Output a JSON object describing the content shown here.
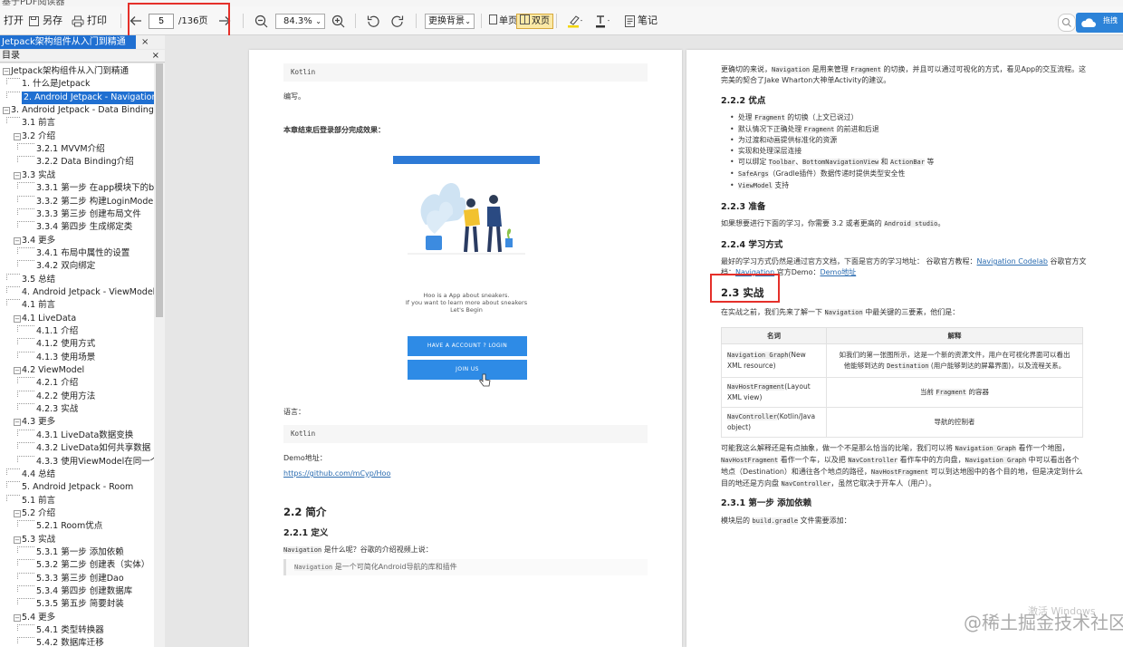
{
  "window_title": "基于PDF阅读器",
  "toolbar": {
    "open": "打开",
    "save_as": "另存",
    "print": "打印",
    "page_current": "5",
    "page_total": "/136页",
    "zoom": "84.3%",
    "background": "更换背景",
    "single_page": "单页",
    "double_page": "双页",
    "note": "笔记"
  },
  "corner_badge": "拖拽",
  "tab": {
    "label": "Jetpack架构组件从入门到精通",
    "close": "×"
  },
  "toc_header": {
    "label": "目录",
    "close": "×"
  },
  "toc": [
    {
      "label": "Jetpack架构组件从入门到精通",
      "level": 0
    },
    {
      "label": "1. 什么是Jetpack",
      "level": 1
    },
    {
      "label": "2. Android Jetpack - Navigation",
      "level": 1,
      "selected": true
    },
    {
      "label": "3. Android Jetpack - Data Binding",
      "level": 0
    },
    {
      "label": "3.1 前言",
      "level": 1
    },
    {
      "label": "3.2 介绍",
      "level": 1
    },
    {
      "label": "3.2.1 MVVM介绍",
      "level": 2
    },
    {
      "label": "3.2.2 Data Binding介绍",
      "level": 2
    },
    {
      "label": "3.3 实战",
      "level": 1
    },
    {
      "label": "3.3.1 第一步 在app模块下的build",
      "level": 2
    },
    {
      "label": "3.3.2 第二步 构建LoginModel",
      "level": 2
    },
    {
      "label": "3.3.3 第三步 创建布局文件",
      "level": 2
    },
    {
      "label": "3.3.4 第四步 生成绑定类",
      "level": 2
    },
    {
      "label": "3.4 更多",
      "level": 1
    },
    {
      "label": "3.4.1 布局中属性的设置",
      "level": 2
    },
    {
      "label": "3.4.2 双向绑定",
      "level": 2
    },
    {
      "label": "3.5 总结",
      "level": 1
    },
    {
      "label": "4. Android Jetpack - ViewModel &",
      "level": 1
    },
    {
      "label": "4.1 前言",
      "level": 1
    },
    {
      "label": "4.1 LiveData",
      "level": 1
    },
    {
      "label": "4.1.1 介绍",
      "level": 2
    },
    {
      "label": "4.1.2 使用方式",
      "level": 2
    },
    {
      "label": "4.1.3 使用场景",
      "level": 2
    },
    {
      "label": "4.2 ViewModel",
      "level": 1
    },
    {
      "label": "4.2.1 介绍",
      "level": 2
    },
    {
      "label": "4.2.2 使用方法",
      "level": 2
    },
    {
      "label": "4.2.3 实战",
      "level": 2
    },
    {
      "label": "4.3 更多",
      "level": 1
    },
    {
      "label": "4.3.1 LiveData数据变换",
      "level": 2
    },
    {
      "label": "4.3.2 LiveData如何共享数据",
      "level": 2
    },
    {
      "label": "4.3.3 使用ViewModel在同一个Ac",
      "level": 2
    },
    {
      "label": "4.4 总结",
      "level": 1
    },
    {
      "label": "5. Android Jetpack - Room",
      "level": 1
    },
    {
      "label": "5.1 前言",
      "level": 1
    },
    {
      "label": "5.2 介绍",
      "level": 1
    },
    {
      "label": "5.2.1 Room优点",
      "level": 2
    },
    {
      "label": "5.3 实战",
      "level": 1
    },
    {
      "label": "5.3.1 第一步 添加依赖",
      "level": 2
    },
    {
      "label": "5.3.2 第二步 创建表（实体）",
      "level": 2
    },
    {
      "label": "5.3.3 第三步 创建Dao",
      "level": 2
    },
    {
      "label": "5.3.4 第四步 创建数据库",
      "level": 2
    },
    {
      "label": "5.3.5 第五步 简要封装",
      "level": 2
    },
    {
      "label": "5.4 更多",
      "level": 1
    },
    {
      "label": "5.4.1 类型转换器",
      "level": 2
    },
    {
      "label": "5.4.2 数据库迁移",
      "level": 2
    }
  ],
  "left_page": {
    "code1": "Kotlin",
    "text_bianxie": "编写。",
    "chapter_end": "本章结束后登录部分完成效果：",
    "phone_line1": "Hoo is a App about sneakers.",
    "phone_line2": "If you want to learn more about sneakers",
    "phone_line3": "Let's Begin",
    "btn_account": "HAVE A ACCOUNT ? LOGIN",
    "btn_join": "JOIN US",
    "language": "语言：",
    "code2": "Kotlin",
    "demo_label": "Demo地址：",
    "demo_url": "https://github.com/mCyp/Hoo",
    "h_intro": "2.2 简介",
    "h_def": "2.2.1 定义",
    "def_text_code": "Navigation",
    "def_text": " 是什么呢？谷歌的介绍视频上说：",
    "quote_code": "Navigation",
    "quote_text": " 是一个可简化Android导航的库和插件"
  },
  "right_page": {
    "intro_line1_a": "更确切的来说，",
    "intro_line1_code1": "Navigation",
    "intro_line1_b": " 是用来管理 ",
    "intro_line1_code2": "Fragment",
    "intro_line1_c": " 的切换，并且可以通过可视化的方式，看见App的交互流程。这",
    "intro_line2": "完美的契合了Jake Wharton大神单Activity的建议。",
    "h_adv": "2.2.2 优点",
    "adv1_a": "处理 ",
    "adv1_code": "Fragment",
    "adv1_b": " 的切换（上文已说过）",
    "adv2_a": "默认情况下正确处理 ",
    "adv2_code": "Fragment",
    "adv2_b": " 的前进和后退",
    "adv3": "为过渡和动画提供标准化的资源",
    "adv4": "实现和处理深层连接",
    "adv5_a": "可以绑定 ",
    "adv5_code1": "Toolbar",
    "adv5_sep1": "、",
    "adv5_code2": "BottomNavigationView",
    "adv5_sep2": " 和 ",
    "adv5_code3": "ActionBar",
    "adv5_b": " 等",
    "adv6_code": "SafeArgs",
    "adv6_b": "（Gradle插件）数据传递时提供类型安全性",
    "adv7_code": "ViewModel",
    "adv7_b": " 支持",
    "h_prep": "2.2.3 准备",
    "prep_text_a": "如果想要进行下面的学习，你需要 3.2 或者更高的 ",
    "prep_code": "Android studio",
    "prep_text_b": "。",
    "h_learn": "2.2.4 学习方式",
    "learn_a": "最好的学习方式仍然是通过官方文档，下面是官方的学习地址： 谷歌官方教程：",
    "learn_link1": "Navigation Codelab",
    "learn_b": " 谷歌官方文",
    "learn_c": "档：",
    "learn_link2": "Navigation",
    "learn_d": " 官方Demo：",
    "learn_link3": "Demo地址",
    "h_practice": "2.3 实战",
    "practice_a": "在实战之前，我们先来了解一下 ",
    "practice_code": "Navigation",
    "practice_b": " 中最关键的三要素，他们是：",
    "table": {
      "head": [
        "名词",
        "解释"
      ],
      "rows": [
        {
          "term_code": "Navigation Graph",
          "term_rest": "(New",
          "term_line2": "XML resource)",
          "desc1": "如我们的第一张图所示，这是一个新的资源文件，用户在可视化界面可以看出",
          "desc2_a": "他能够到达的 ",
          "desc2_code": "Destination",
          "desc2_b": " (用户能够到达的屏幕界面)，以及流程关系。"
        },
        {
          "term_code": "NavHostFragment",
          "term_rest": "(Layout",
          "term_line2": "XML view)",
          "desc1_a": "当前 ",
          "desc1_code": "Fragment",
          "desc1_b": " 的容器"
        },
        {
          "term_code": "NavController",
          "term_rest": "(Kotlin/Java",
          "term_line2": "object)",
          "desc1": "导航的控制者"
        }
      ]
    },
    "para1_a": "可能我这么解释还是有点抽象，做一个不是那么恰当的比喻，我们可以将 ",
    "para1_code": "Navigation Graph",
    "para1_b": " 看作一个地图，",
    "para2_code1": "NavHostFragment",
    "para2_a": " 看作一个车，以及把 ",
    "para2_code2": "NavController",
    "para2_b": " 看作车中的方向盘，",
    "para2_code3": "Navigation Graph",
    "para2_c": " 中可以看出各个",
    "para3_a": "地点（Destination）和通往各个地点的路径，",
    "para3_code": "NavHostFragment",
    "para3_b": " 可以到达地图中的各个目的地，但是决定到什么",
    "para4_a": "目的地还是方向盘 ",
    "para4_code": "NavController",
    "para4_b": "，虽然它取决于开车人（用户）。",
    "h_step1": "2.3.1 第一步 添加依赖",
    "dep_a": "模块层的 ",
    "dep_code": "build.gradle",
    "dep_b": " 文件需要添加："
  },
  "watermark": "@稀土掘金技术社区",
  "windows_activate": "激活 Windows"
}
